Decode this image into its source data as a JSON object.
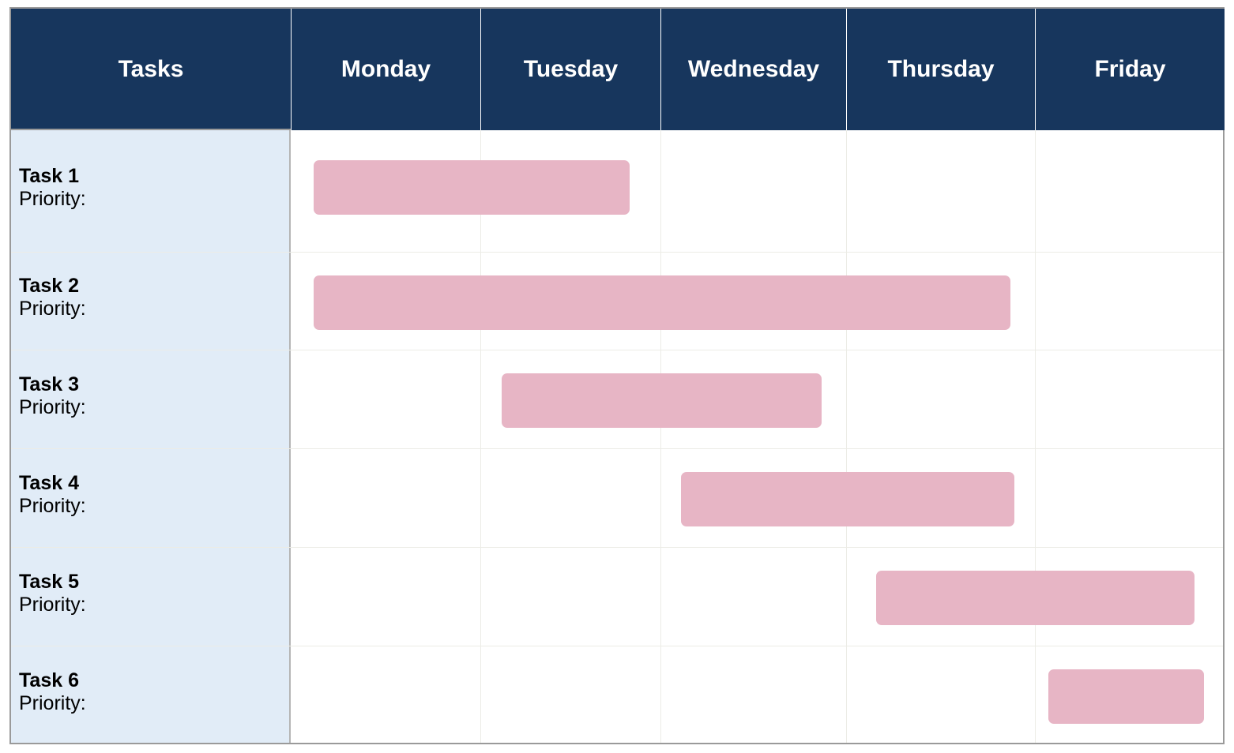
{
  "chart_data": {
    "type": "gantt",
    "title": "",
    "header_first_column": "Tasks",
    "days": [
      "Monday",
      "Tuesday",
      "Wednesday",
      "Thursday",
      "Friday"
    ],
    "priority_label": "Priority:",
    "tasks": [
      {
        "name": "Task 1",
        "priority": "",
        "start": 0.12,
        "end": 1.83
      },
      {
        "name": "Task 2",
        "priority": "",
        "start": 0.12,
        "end": 3.87
      },
      {
        "name": "Task 3",
        "priority": "",
        "start": 1.12,
        "end": 2.87
      },
      {
        "name": "Task 4",
        "priority": "",
        "start": 2.11,
        "end": 3.89
      },
      {
        "name": "Task 5",
        "priority": "",
        "start": 3.16,
        "end": 4.84
      },
      {
        "name": "Task 6",
        "priority": "",
        "start": 4.07,
        "end": 4.89
      }
    ]
  },
  "colors": {
    "header_bg": "#17365d",
    "header_text": "#ffffff",
    "task_column_bg": "#e1ecf7",
    "bar_fill": "#e7b5c5"
  }
}
